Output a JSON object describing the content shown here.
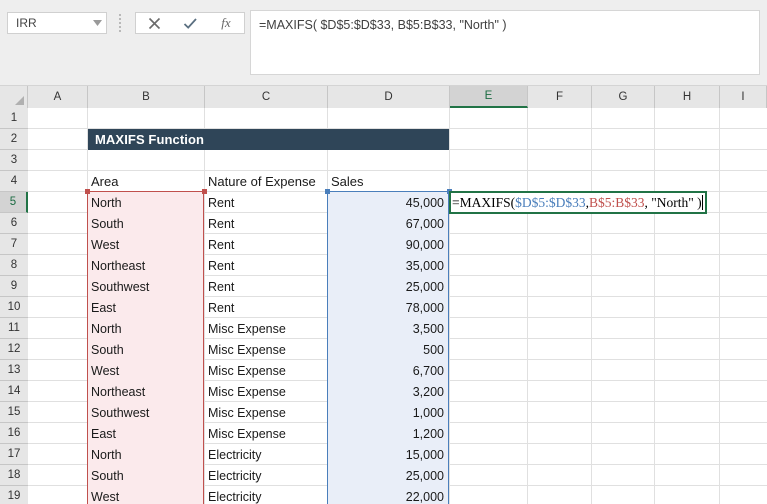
{
  "app": {
    "name_box_value": "IRR",
    "name_box_icon": "chevron-down-icon",
    "cancel_icon": "close-icon",
    "confirm_icon": "check-icon",
    "insert_function_icon": "fx-icon",
    "insert_function_label": "fx",
    "formula_bar_text": "=MAXIFS( $D$5:$D$33, B$5:B$33, \"North\" )"
  },
  "grid": {
    "columns": [
      "A",
      "B",
      "C",
      "D",
      "E",
      "F",
      "G",
      "H",
      "I"
    ],
    "active_column": "E",
    "rows": [
      "1",
      "2",
      "3",
      "4",
      "5",
      "6",
      "7",
      "8",
      "9",
      "10",
      "11",
      "12",
      "13",
      "14",
      "15",
      "16",
      "17",
      "18",
      "19"
    ],
    "active_row": "5",
    "title_banner": "MAXIFS Function",
    "headers": {
      "area": "Area",
      "nature": "Nature of Expense",
      "sales": "Sales"
    },
    "table": [
      {
        "row": "5",
        "area": "North",
        "nature": "Rent",
        "sales": "45,000"
      },
      {
        "row": "6",
        "area": "South",
        "nature": "Rent",
        "sales": "67,000"
      },
      {
        "row": "7",
        "area": "West",
        "nature": "Rent",
        "sales": "90,000"
      },
      {
        "row": "8",
        "area": "Northeast",
        "nature": "Rent",
        "sales": "35,000"
      },
      {
        "row": "9",
        "area": "Southwest",
        "nature": "Rent",
        "sales": "25,000"
      },
      {
        "row": "10",
        "area": "East",
        "nature": "Rent",
        "sales": "78,000"
      },
      {
        "row": "11",
        "area": "North",
        "nature": "Misc Expense",
        "sales": "3,500"
      },
      {
        "row": "12",
        "area": "South",
        "nature": "Misc Expense",
        "sales": "500"
      },
      {
        "row": "13",
        "area": "West",
        "nature": "Misc Expense",
        "sales": "6,700"
      },
      {
        "row": "14",
        "area": "Northeast",
        "nature": "Misc Expense",
        "sales": "3,200"
      },
      {
        "row": "15",
        "area": "Southwest",
        "nature": "Misc Expense",
        "sales": "1,000"
      },
      {
        "row": "16",
        "area": "East",
        "nature": "Misc Expense",
        "sales": "1,200"
      },
      {
        "row": "17",
        "area": "North",
        "nature": "Electricity",
        "sales": "15,000"
      },
      {
        "row": "18",
        "area": "South",
        "nature": "Electricity",
        "sales": "25,000"
      },
      {
        "row": "19",
        "area": "West",
        "nature": "Electricity",
        "sales": "22,000"
      }
    ]
  },
  "edit_cell": {
    "address": "E5",
    "tokens": [
      {
        "text": "=MAXIFS( ",
        "color": "plain"
      },
      {
        "text": "$D$5:$D$33",
        "color": "blue"
      },
      {
        "text": ", ",
        "color": "plain"
      },
      {
        "text": "B$5:B$33",
        "color": "red"
      },
      {
        "text": ", \"North\" )",
        "color": "plain"
      }
    ]
  },
  "colors": {
    "banner_bg": "#2f4558",
    "tint_pink": "#fbeaec",
    "tint_blue": "#e9eef8",
    "range_blue": "#4a7ebb",
    "range_red": "#c0504d",
    "active_green": "#217346",
    "header_gray": "#e6e6e6"
  }
}
